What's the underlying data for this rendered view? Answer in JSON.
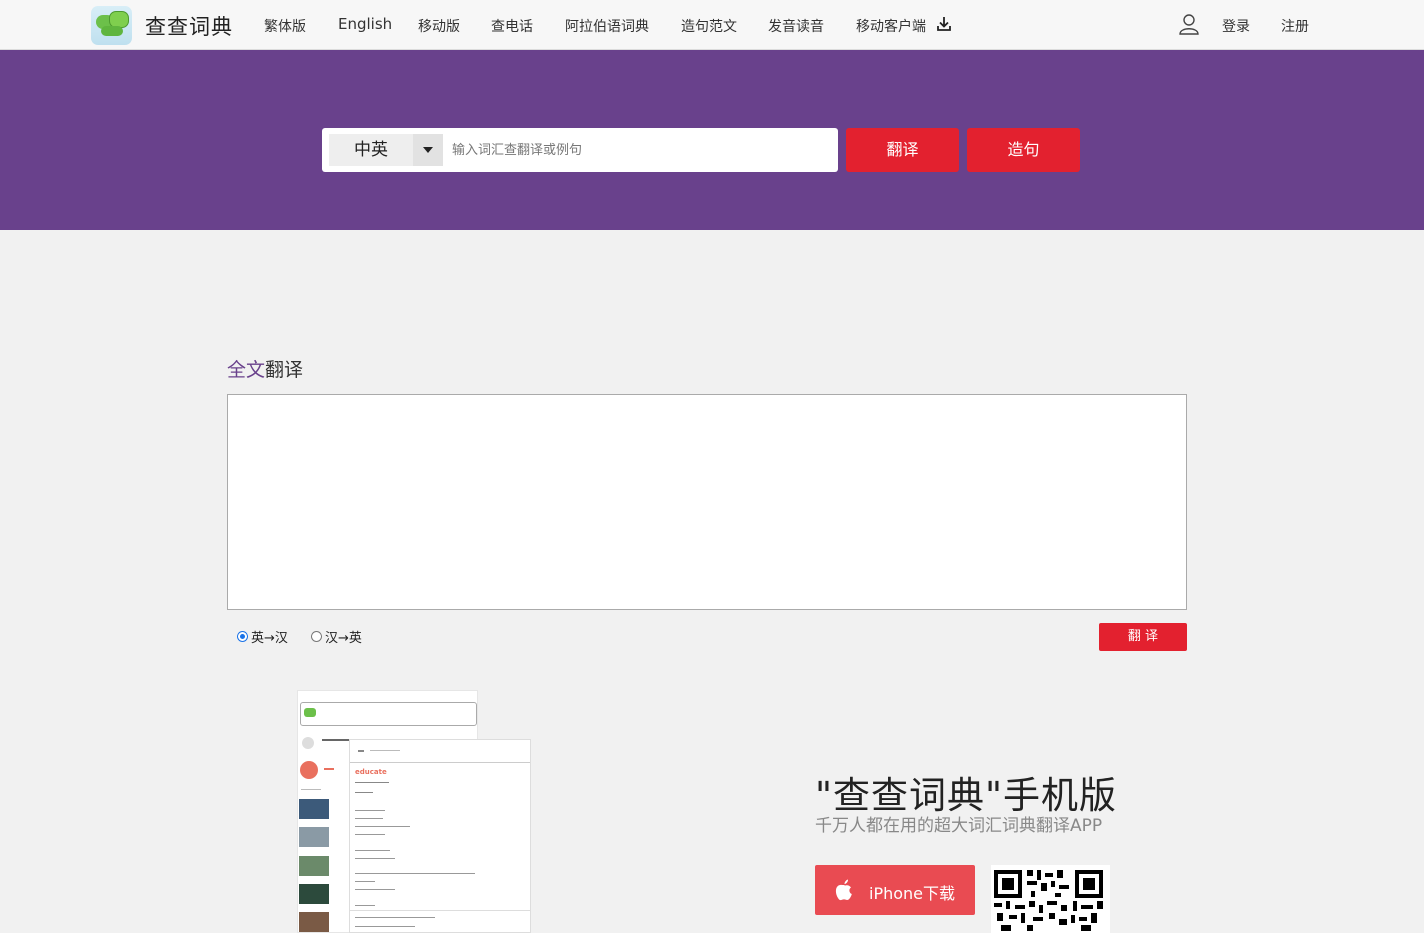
{
  "header": {
    "brand": "查查词典",
    "nav": [
      "繁体版",
      "English",
      "移动版",
      "查电话",
      "阿拉伯语词典",
      "造句范文",
      "发音读音",
      "移动客户端"
    ],
    "login": "登录",
    "register": "注册"
  },
  "search": {
    "lang_selected": "中英",
    "placeholder": "输入词汇查翻译或例句",
    "translate_button": "翻译",
    "sentence_button": "造句"
  },
  "fulltext": {
    "title_highlight": "全文",
    "title_rest": "翻译",
    "options": [
      "英→汉",
      "汉→英"
    ],
    "selected_option": "英→汉",
    "translate_button": "翻 译"
  },
  "app_promo": {
    "title": "\"查查词典\"手机版",
    "subtitle": "千万人都在用的超大词汇词典翻译APP",
    "iphone_button": "iPhone下载",
    "preview_word": "educate"
  },
  "colors": {
    "brand_purple": "#69418c",
    "accent_red": "#e3212f",
    "iphone_red": "#e94b52"
  }
}
